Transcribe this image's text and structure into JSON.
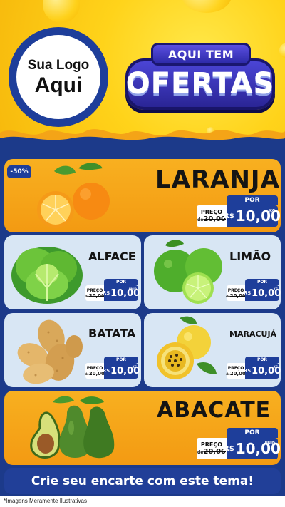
{
  "header": {
    "logo_line1": "Sua Logo",
    "logo_line2": "Aqui",
    "badge_top": "AQUI TEM",
    "badge_main": "OFERTAS"
  },
  "colors": {
    "primary_blue": "#1e3e9a",
    "yellow": "#ffd31a",
    "orange": "#f7a515",
    "light_card": "#d8e6f4"
  },
  "products": {
    "laranja": {
      "discount": "-50%",
      "name": "LARANJA",
      "por": "POR",
      "preco": "PREÇO",
      "de": "de",
      "old": "20,00",
      "currency": "R$",
      "price": "10,00",
      "unit": "KG",
      "icon": "orange-fruit"
    },
    "alface": {
      "name": "ALFACE",
      "por": "POR",
      "preco": "PREÇO",
      "de": "de",
      "old": "20,00",
      "currency": "R$",
      "price": "10,00",
      "unit": "UNID",
      "icon": "lettuce"
    },
    "limao": {
      "name": "LIMÃO",
      "por": "POR",
      "preco": "PREÇO",
      "de": "de",
      "old": "20,00",
      "currency": "R$",
      "price": "10,00",
      "unit": "KG",
      "icon": "lime"
    },
    "batata": {
      "name": "BATATA",
      "por": "POR",
      "preco": "PREÇO",
      "de": "de",
      "old": "20,00",
      "currency": "R$",
      "price": "10,00",
      "unit": "KG",
      "icon": "potato"
    },
    "maracuja": {
      "name": "MARACUJÁ",
      "por": "POR",
      "preco": "PREÇO",
      "de": "de",
      "old": "20,00",
      "currency": "R$",
      "price": "10,00",
      "unit": "KG",
      "icon": "passion-fruit"
    },
    "abacate": {
      "name": "ABACATE",
      "por": "POR",
      "preco": "PREÇO",
      "de": "de",
      "old": "20,00",
      "currency": "R$",
      "price": "10,00",
      "unit": "UNID",
      "icon": "avocado"
    }
  },
  "cta": "Crie seu encarte com este tema!",
  "footnote": "*Imagens Meramente Ilustrativas"
}
